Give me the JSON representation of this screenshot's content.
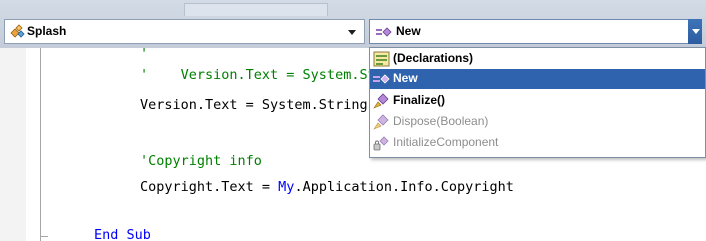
{
  "navigation": {
    "class_combo": {
      "value": "Splash",
      "icon": "class-icon"
    },
    "member_combo": {
      "value": "New",
      "icon": "method-icon"
    }
  },
  "editor": {
    "lines": [
      {
        "id": "l1",
        "segments": [
          {
            "kind": "comment",
            "text": "'"
          }
        ]
      },
      {
        "id": "l2",
        "segments": [
          {
            "kind": "comment",
            "text": "'    Version.Text = System.String.Format(Version.Text, My.Application.Info.Version.Major"
          }
        ]
      },
      {
        "id": "l3",
        "segments": [
          {
            "kind": "plain",
            "text": "Version.Text = System.String.Format(Version.Text, My.Application.Info.Version.Major"
          }
        ]
      },
      {
        "id": "l4",
        "segments": [
          {
            "kind": "comment",
            "text": "'Copyright info"
          }
        ]
      },
      {
        "id": "l5",
        "segments": [
          {
            "kind": "plain",
            "text": "Copyright.Text = "
          },
          {
            "kind": "keyword",
            "text": "My"
          },
          {
            "kind": "plain",
            "text": ".Application.Info.Copyright"
          }
        ]
      },
      {
        "id": "l6",
        "segments": [
          {
            "kind": "keyword",
            "text": "End Sub"
          }
        ]
      }
    ],
    "colors": {
      "comment": "#008000",
      "keyword": "#0000ff",
      "plain": "#000000"
    }
  },
  "dropdown": {
    "items": [
      {
        "label": "(Declarations)",
        "icon": "declarations-icon",
        "state": "normal"
      },
      {
        "label": "New",
        "icon": "method-icon",
        "state": "selected"
      },
      {
        "label": "Finalize()",
        "icon": "protected-method-icon",
        "state": "normal"
      },
      {
        "label": "Dispose(Boolean)",
        "icon": "protected-method-icon",
        "state": "dim"
      },
      {
        "label": "InitializeComponent",
        "icon": "private-method-icon",
        "state": "dim"
      }
    ],
    "selection_color": "#2f63ad"
  }
}
